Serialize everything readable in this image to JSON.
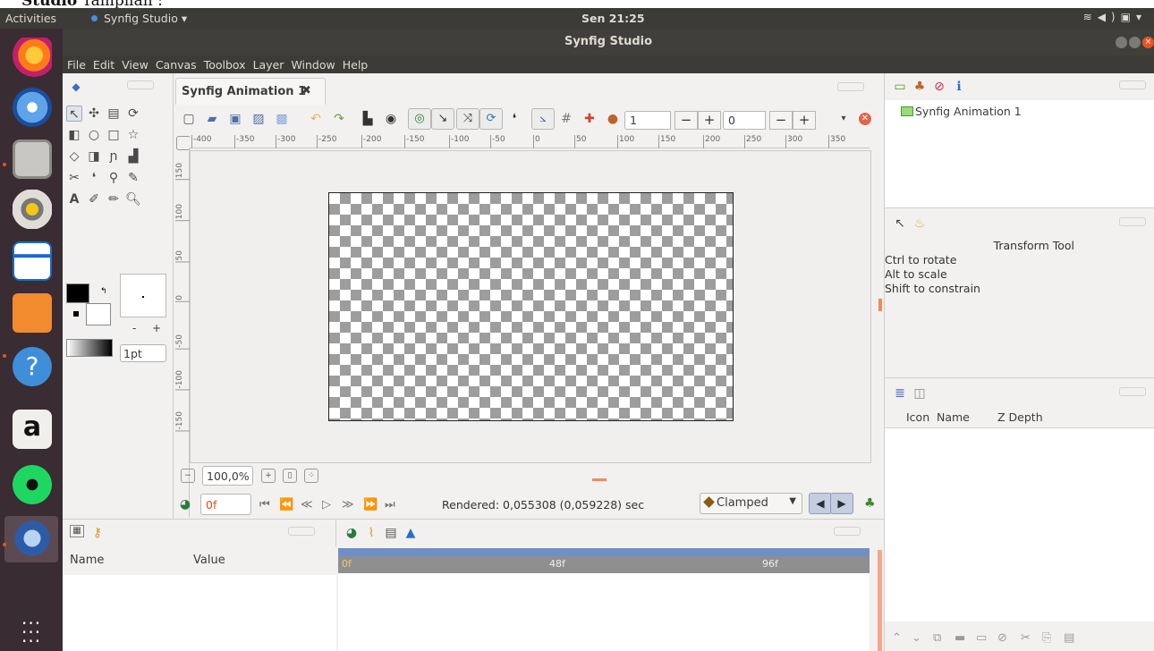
{
  "doc_caption": {
    "bold": "Studio",
    "rest": " Tampilan :"
  },
  "top_panel": {
    "activities": "Activities",
    "app_menu": "Synfig Studio ▾",
    "clock": "Sen 21:25",
    "status_icons": [
      "wifi-icon",
      "volume-icon",
      "battery-icon",
      "menu-caret-icon"
    ]
  },
  "window": {
    "title": "Synfig Studio"
  },
  "menubar": {
    "items": [
      "File",
      "Edit",
      "View",
      "Canvas",
      "Toolbox",
      "Layer",
      "Window",
      "Help"
    ]
  },
  "dock": {
    "apps": [
      "firefox-icon",
      "thunderbird-icon",
      "files-icon",
      "rhythmbox-icon",
      "writer-icon",
      "software-center-icon",
      "help-icon",
      "amazon-icon",
      "spotify-icon",
      "synfig-icon",
      "app-grid-icon"
    ],
    "help_glyph": "?",
    "amazon_glyph": "a"
  },
  "toolbox": {
    "width_value": "1pt",
    "size_minus": "-",
    "size_plus": "+"
  },
  "canvas": {
    "tab_label": "Synfig Animation 1",
    "tab_close": "✖",
    "frame_field_a": "1",
    "frame_field_b": "0",
    "plus": "+",
    "minus": "−",
    "hruler_ticks": [
      "-400",
      "-350",
      "-300",
      "-250",
      "-200",
      "-150",
      "-100",
      "-50",
      "0",
      "50",
      "100",
      "150",
      "200",
      "250",
      "300",
      "350"
    ],
    "vruler_ticks": [
      "150",
      "100",
      "50",
      "0",
      "-50",
      "-100",
      "-150"
    ],
    "zoom": "100,0%",
    "current_frame": "0f",
    "rendered": "Rendered: 0,055308 (0,059228) sec",
    "interpolation": "Clamped"
  },
  "canvas_browser": {
    "item": "Synfig Animation 1"
  },
  "tool_options": {
    "title": "Transform Tool",
    "hints": [
      "Ctrl to rotate",
      "Alt to scale",
      "Shift to constrain"
    ]
  },
  "layers": {
    "columns": [
      "Icon",
      "Name",
      "Z Depth"
    ]
  },
  "params": {
    "columns": [
      "Name",
      "Value"
    ]
  },
  "timeline": {
    "marks": [
      "0f",
      "48f",
      "96f"
    ]
  },
  "colors": {
    "panel": "#f2f1f0",
    "topbar": "#3c3b37",
    "dock": "#3a2c33",
    "accent": "#e95420",
    "timeline_blue": "#6f8fc7"
  }
}
